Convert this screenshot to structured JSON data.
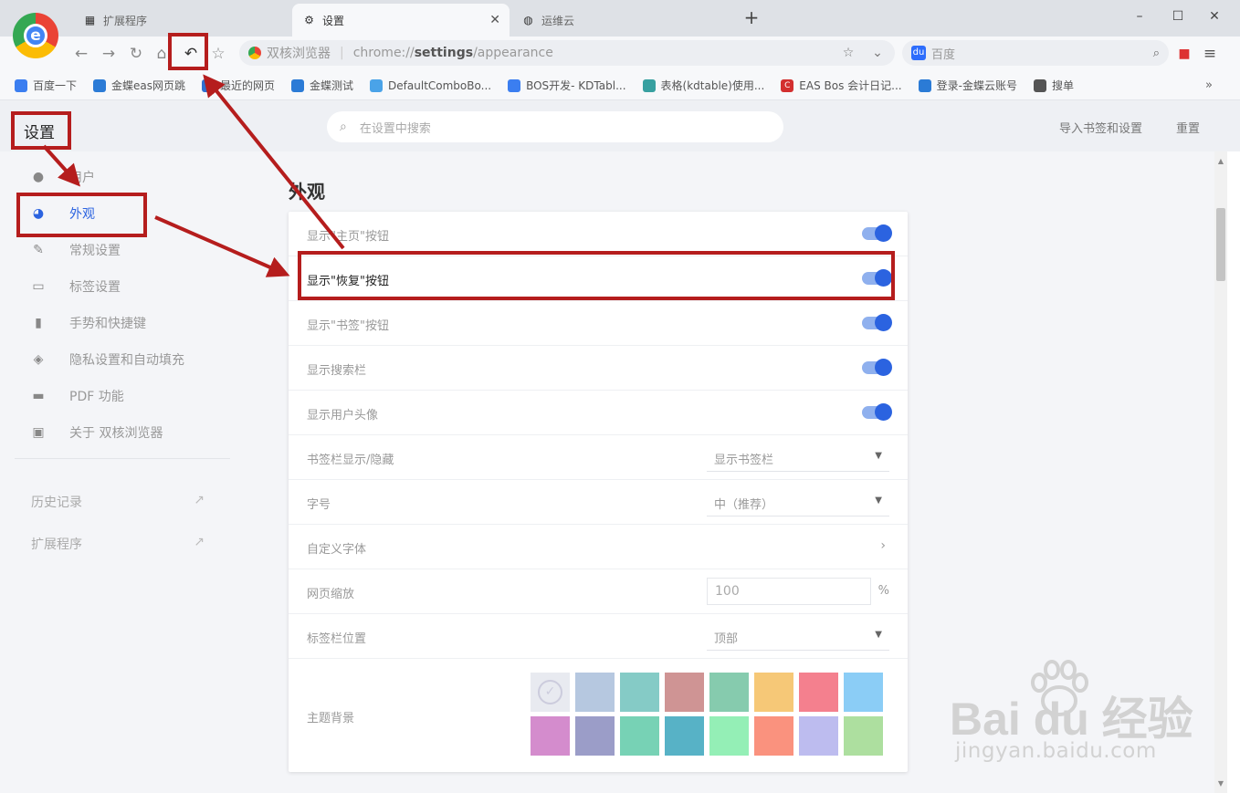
{
  "browser": {
    "tabs": [
      {
        "title": "扩展程序",
        "icon": "grid-icon"
      },
      {
        "title": "设置",
        "icon": "gear-icon"
      },
      {
        "title": "运维云",
        "icon": "globe-icon"
      }
    ],
    "address": {
      "site": "双核浏览器",
      "url_prefix": "chrome://",
      "url_bold": "settings",
      "url_suffix": "/appearance"
    },
    "search_placeholder": "百度",
    "bookmarks": [
      {
        "label": "百度一下",
        "color": "#3b7ef0"
      },
      {
        "label": "金蝶eas网页跳",
        "color": "#2b7bd6"
      },
      {
        "label": "最近的网页",
        "color": "#2f6fd0"
      },
      {
        "label": "金蝶测试",
        "color": "#2b7bd6"
      },
      {
        "label": "DefaultComboBo...",
        "color": "#4aa3e8"
      },
      {
        "label": "BOS开发- KDTabl...",
        "color": "#3b7ef0"
      },
      {
        "label": "表格(kdtable)使用...",
        "color": "#37a0a0"
      },
      {
        "label": "EAS Bos 会计日记...",
        "color": "#d32f2f"
      },
      {
        "label": "登录-金蝶云账号",
        "color": "#2b7bd6"
      },
      {
        "label": "搜单",
        "color": "#555555"
      }
    ]
  },
  "settings": {
    "title": "设置",
    "search_placeholder": "在设置中搜索",
    "import_link": "导入书签和设置",
    "header_right": "重置",
    "nav": [
      {
        "label": "用户",
        "icon": "user-icon"
      },
      {
        "label": "外观",
        "icon": "palette-icon",
        "active": true
      },
      {
        "label": "常规设置",
        "icon": "wrench-icon"
      },
      {
        "label": "标签设置",
        "icon": "tab-icon"
      },
      {
        "label": "手势和快捷键",
        "icon": "mouse-icon"
      },
      {
        "label": "隐私设置和自动填充",
        "icon": "shield-icon"
      },
      {
        "label": "PDF 功能",
        "icon": "pdf-icon"
      },
      {
        "label": "关于 双核浏览器",
        "icon": "info-icon"
      }
    ],
    "external_links": [
      "历史记录",
      "扩展程序"
    ],
    "section_title": "外观",
    "rows": [
      {
        "label": "显示\"主页\"按钮",
        "type": "toggle",
        "on": true
      },
      {
        "label": "显示\"恢复\"按钮",
        "type": "toggle",
        "on": true
      },
      {
        "label": "显示\"书签\"按钮",
        "type": "toggle",
        "on": true
      },
      {
        "label": "显示搜索栏",
        "type": "toggle",
        "on": true
      },
      {
        "label": "显示用户头像",
        "type": "toggle",
        "on": true
      },
      {
        "label": "书签栏显示/隐藏",
        "type": "select",
        "value": "显示书签栏"
      },
      {
        "label": "字号",
        "type": "select",
        "value": "中（推荐）"
      },
      {
        "label": "自定义字体",
        "type": "arrow"
      },
      {
        "label": "网页缩放",
        "type": "input",
        "value": "100",
        "unit": "%"
      },
      {
        "label": "标签栏位置",
        "type": "select",
        "value": "顶部"
      }
    ],
    "theme_label": "主题背景",
    "theme_colors": [
      "#e8eaf0",
      "#b6c8e0",
      "#85cbc6",
      "#cf9494",
      "#86cbae",
      "#f6c877",
      "#f4808e",
      "#8bcdf6",
      "#d48ccd",
      "#9b9dc8",
      "#77d2b5",
      "#57b2c6",
      "#94efb6",
      "#fa927e",
      "#bdbcef",
      "#addf9f"
    ]
  },
  "watermark": {
    "brand": "Bai du 经验",
    "sub": "jingyan.baidu.com"
  }
}
